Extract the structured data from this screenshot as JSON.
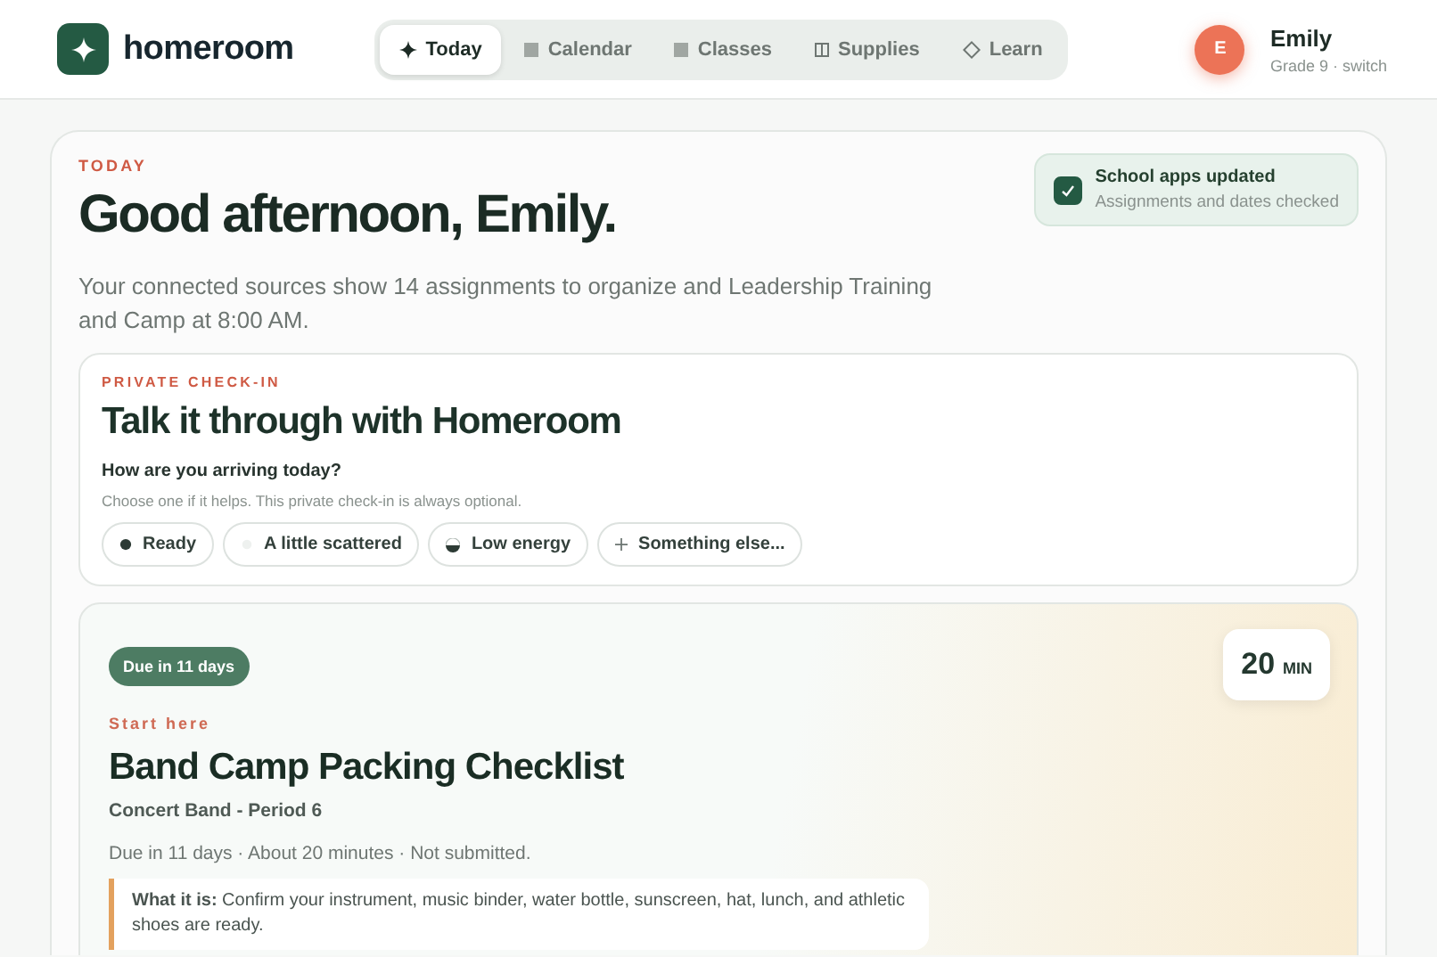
{
  "app": {
    "name": "homeroom"
  },
  "nav": [
    {
      "label": "Today",
      "selected": true
    },
    {
      "label": "Calendar",
      "selected": false
    },
    {
      "label": "Classes",
      "selected": false
    },
    {
      "label": "Supplies",
      "selected": false
    },
    {
      "label": "Learn",
      "selected": false
    }
  ],
  "user": {
    "initial": "E",
    "name": "Emily",
    "detail": "Grade 9 · switch"
  },
  "today": {
    "eyebrow": "TODAY",
    "greeting": "Good afternoon, Emily.",
    "summary": "Your connected sources show 14 assignments to organize and Leadership Training and Camp at 8:00 AM.",
    "sync": {
      "checked": true,
      "title": "School apps updated",
      "detail": "Assignments and dates checked"
    }
  },
  "checkin": {
    "eyebrow": "PRIVATE CHECK-IN",
    "title": "Talk it through with Homeroom",
    "question": "How are you arriving today?",
    "hint": "Choose one if it helps. This private check-in is always optional.",
    "moods": [
      {
        "label": "Ready",
        "selected": false
      },
      {
        "label": "A little scattered",
        "selected": false
      },
      {
        "label": "Low energy",
        "selected": false
      },
      {
        "label": "Something else...",
        "selected": false
      }
    ]
  },
  "assignment": {
    "badge": "Due in 11 days",
    "minutes": "20",
    "unit": "MIN",
    "eyebrow": "Start here",
    "title": "Band Camp Packing Checklist",
    "course": "Concert Band - Period 6",
    "meta": "Due in 11 days · About 20 minutes · Not submitted.",
    "description": "**What it is:** Confirm your instrument, music binder, water bottle, sunscreen, hat, lunch, and athletic shoes are ready."
  }
}
